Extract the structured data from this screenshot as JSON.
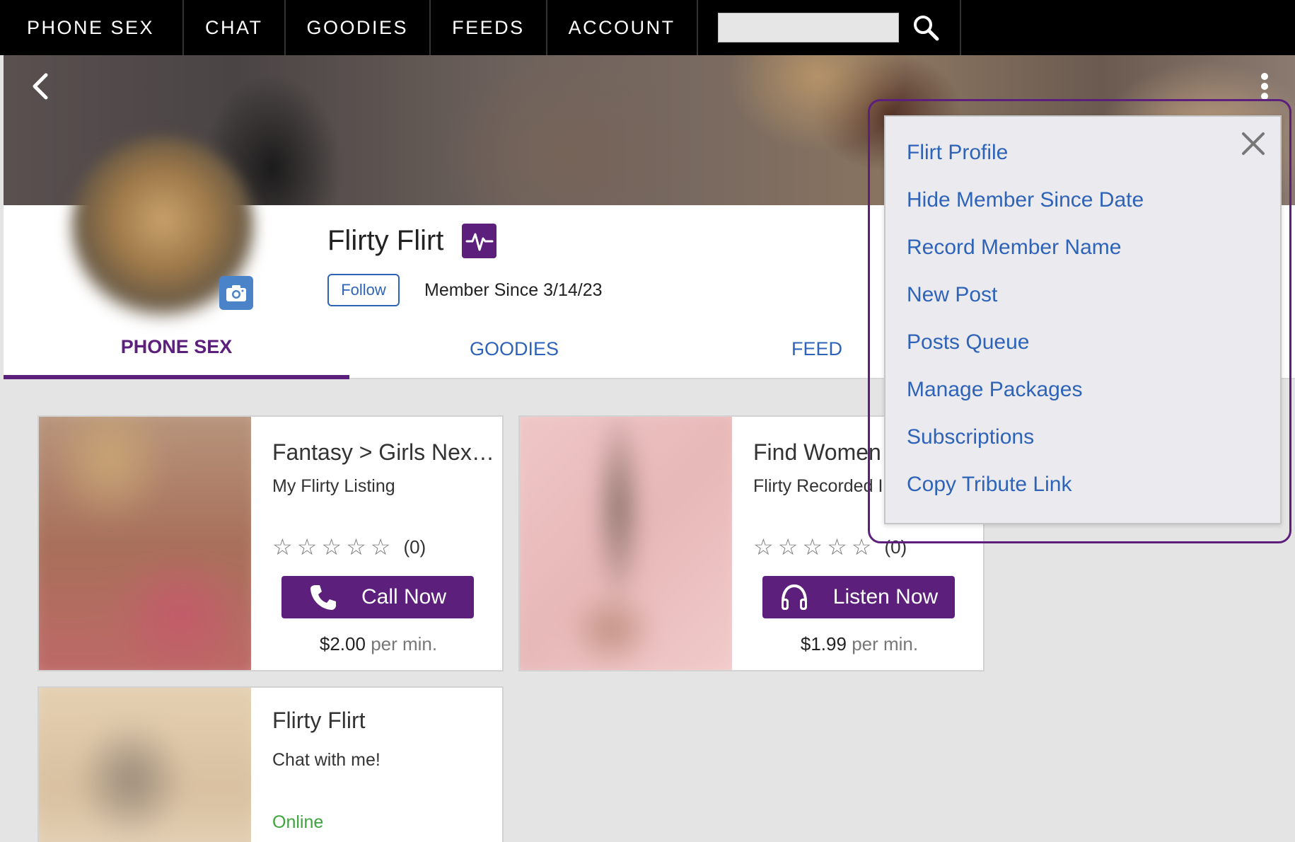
{
  "nav": {
    "items": [
      "PHONE SEX",
      "CHAT",
      "GOODIES",
      "FEEDS",
      "ACCOUNT"
    ],
    "search": {
      "value": "",
      "placeholder": ""
    }
  },
  "profile": {
    "name": "Flirty Flirt",
    "follow_label": "Follow",
    "member_since": "Member Since 3/14/23"
  },
  "tabs": [
    {
      "label": "PHONE SEX",
      "active": true
    },
    {
      "label": "GOODIES",
      "active": false
    },
    {
      "label": "FEED",
      "active": false
    }
  ],
  "cards": [
    {
      "title": "Fantasy > Girls Nex…",
      "subtitle": "My Flirty Listing",
      "rating_count": "(0)",
      "action_label": "Call Now",
      "action_icon": "phone-icon",
      "price": "$2.00",
      "price_unit": "per min."
    },
    {
      "title": "Find Women",
      "subtitle": "Flirty Recorded I",
      "rating_count": "(0)",
      "action_label": "Listen Now",
      "action_icon": "headphones-icon",
      "price": "$1.99",
      "price_unit": "per min."
    },
    {
      "title": "Flirty Flirt",
      "subtitle": "Chat with me!",
      "status": "Online"
    }
  ],
  "menu": {
    "items": [
      "Flirt Profile",
      "Hide Member Since Date",
      "Record Member Name",
      "New Post",
      "Posts Queue",
      "Manage Packages",
      "Subscriptions",
      "Copy Tribute Link"
    ]
  },
  "colors": {
    "brand_purple": "#5d1f7c",
    "link_blue": "#2e63b8",
    "online_green": "#3fa33f",
    "nav_bg": "#000000"
  }
}
